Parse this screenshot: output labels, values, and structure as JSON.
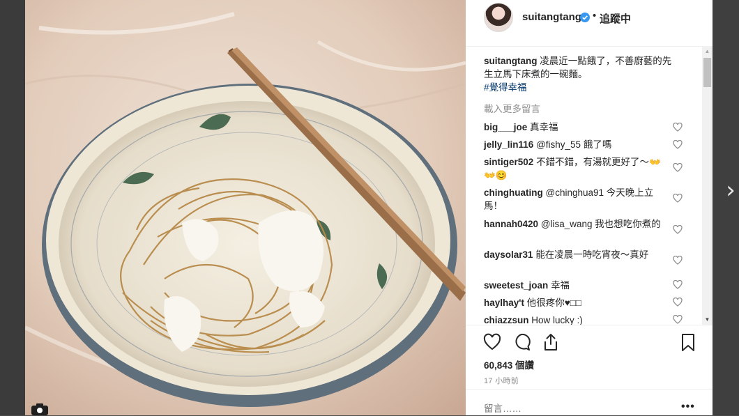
{
  "post": {
    "username": "suitangtang",
    "follow_status": "追蹤中",
    "dot": "•",
    "caption_user": "suitangtang",
    "caption_text": "凌晨近一點餓了，不善廚藝的先生立馬下床煮的一碗麵。",
    "hashtag": "#覺得幸福",
    "load_more": "載入更多留言",
    "likes": "60,843 個讚",
    "time": "17 小時前",
    "comment_placeholder": "留言……",
    "more": "•••"
  },
  "comments": [
    {
      "user": "big___joe",
      "text": "真幸福"
    },
    {
      "user": "jelly_lin116",
      "text": "@fishy_55 餓了嗎"
    },
    {
      "user": "sintiger502",
      "text": "不錯不錯，有湯就更好了～👐👐😊"
    },
    {
      "user": "chinghuating",
      "text": "@chinghua91 今天晚上立馬！"
    },
    {
      "user": "hannah0420",
      "text": "@lisa_wang 我也想吃你煮的"
    },
    {
      "user": "daysolar31",
      "text": "能在凌晨一時吃宵夜～真好"
    },
    {
      "user": "sweetest_joan",
      "text": "幸福"
    },
    {
      "user": "haylhay't",
      "text": "他很疼你♥□□"
    },
    {
      "user": "chiazzsun",
      "text": "How lucky :)"
    }
  ],
  "icons": {
    "next": "chevron-right-icon",
    "verified": "verified-badge-icon",
    "like": "heart-icon",
    "comment": "comment-bubble-icon",
    "share": "share-icon",
    "save": "bookmark-icon",
    "more": "more-options-icon",
    "camera": "camera-icon"
  },
  "colors": {
    "verified_blue": "#3897f0",
    "text": "#262626",
    "muted": "#8e8e8e",
    "hashtag": "#003569"
  }
}
